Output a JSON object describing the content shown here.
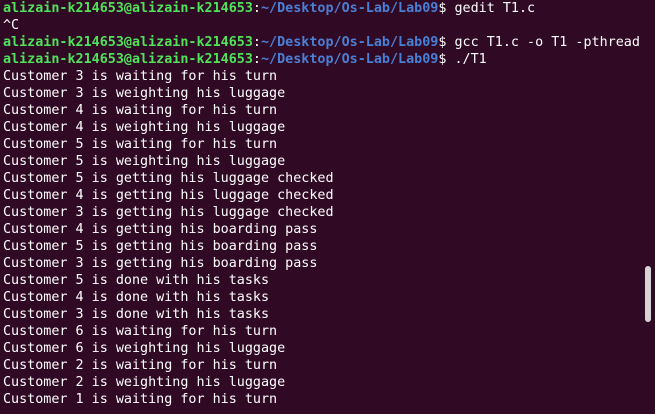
{
  "terminal": {
    "prompt_user": "alizain-k214653@alizain-k214653",
    "prompt_path": "~/Desktop/Os-Lab/Lab09",
    "commands": [
      "gedit T1.c",
      "gcc T1.c -o T1 -pthread",
      "./T1"
    ],
    "interrupt_line": "^C",
    "output_lines": [
      "Customer 3 is waiting for his turn",
      "Customer 3 is weighting his luggage",
      "Customer 4 is waiting for his turn",
      "Customer 4 is weighting his luggage",
      "Customer 5 is waiting for his turn",
      "Customer 5 is weighting his luggage",
      "Customer 5 is getting his luggage checked",
      "Customer 4 is getting his luggage checked",
      "Customer 3 is getting his luggage checked",
      "Customer 4 is getting his boarding pass",
      "Customer 5 is getting his boarding pass",
      "Customer 3 is getting his boarding pass",
      "Customer 5 is done with his tasks",
      "Customer 4 is done with his tasks",
      "Customer 3 is done with his tasks",
      "Customer 6 is waiting for his turn",
      "Customer 6 is weighting his luggage",
      "Customer 2 is waiting for his turn",
      "Customer 2 is weighting his luggage",
      "Customer 1 is waiting for his turn"
    ]
  },
  "colors": {
    "background": "#300a24",
    "prompt_user": "#4fe35a",
    "prompt_path": "#4a7fd6",
    "text": "#ffffff"
  },
  "scrollbar": {
    "position_fraction": 0.64
  }
}
